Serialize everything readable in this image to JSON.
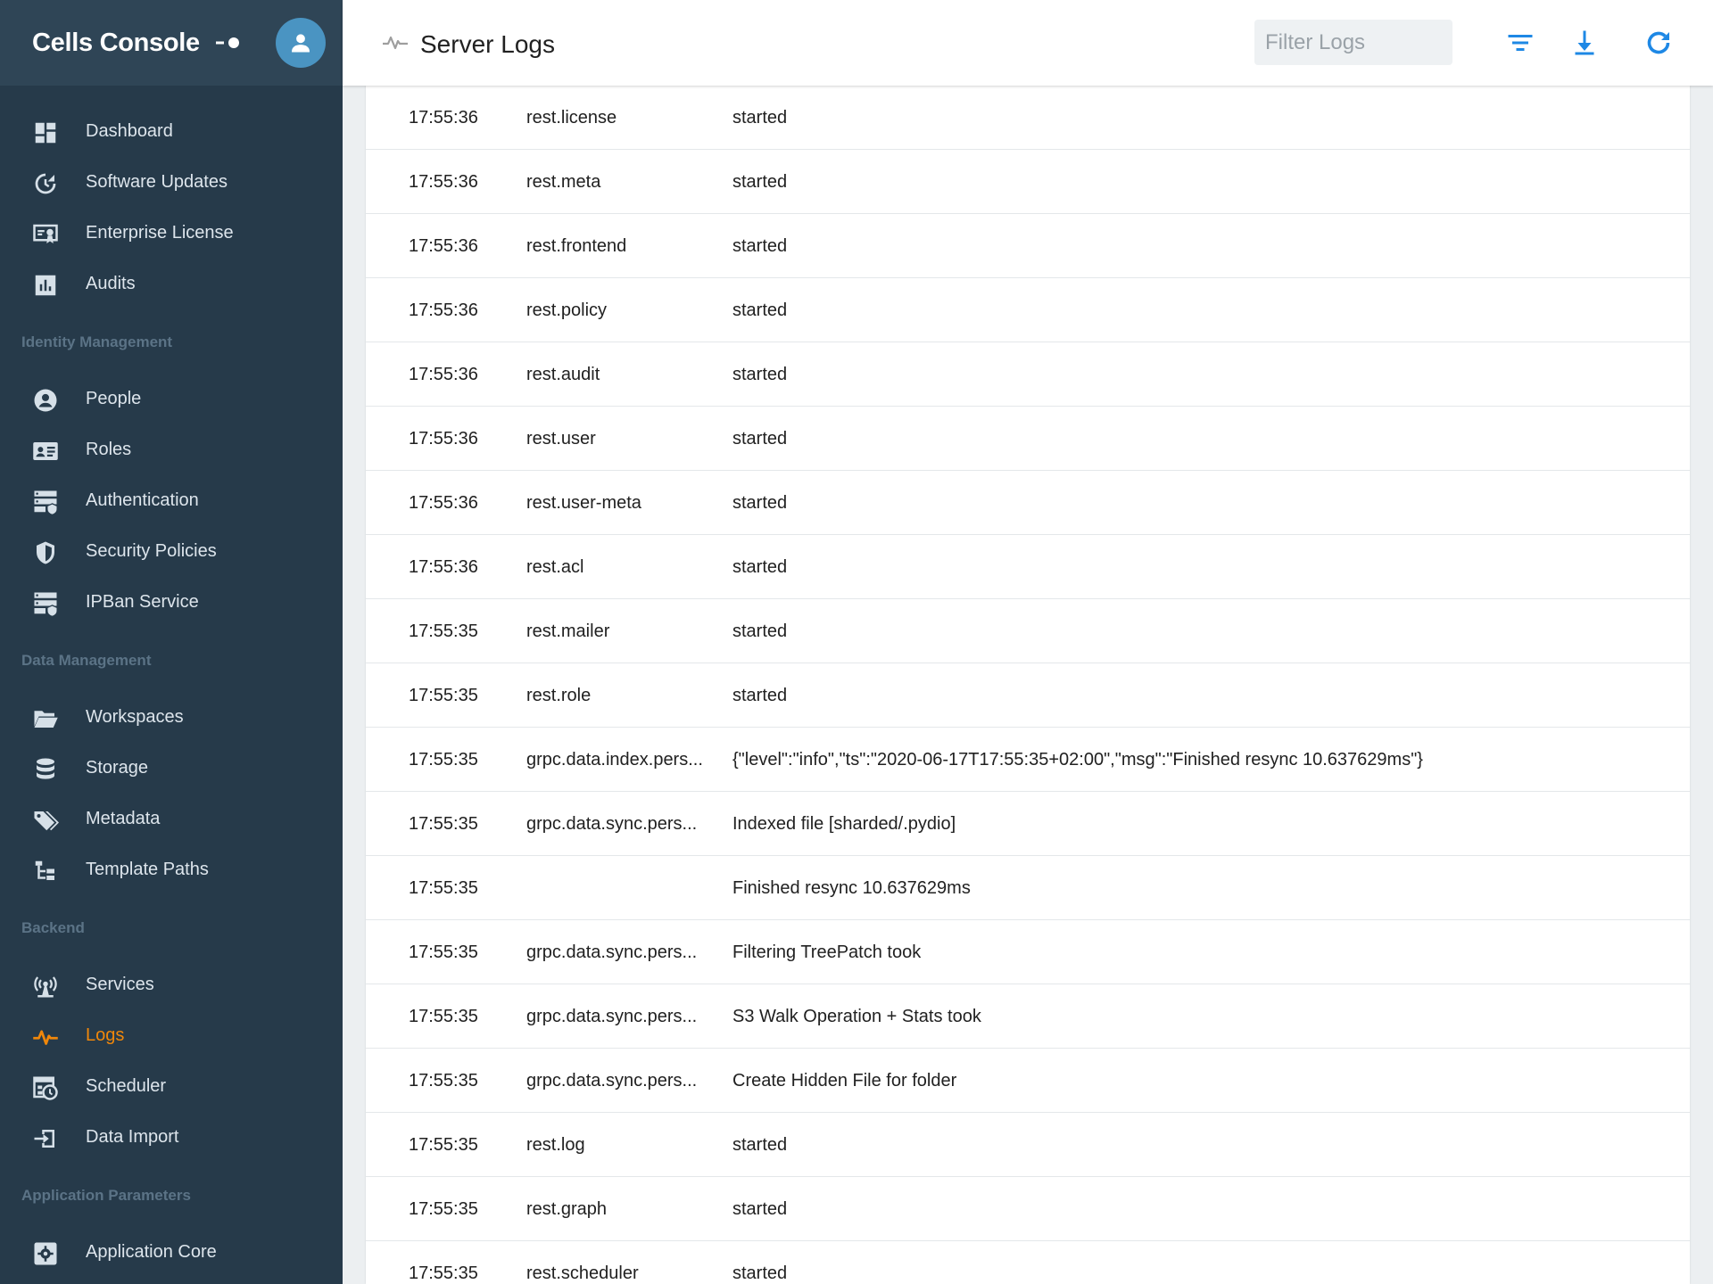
{
  "sidebar": {
    "brand": "Cells Console",
    "top_items": [
      {
        "label": "Dashboard",
        "icon": "dashboard-icon"
      },
      {
        "label": "Software Updates",
        "icon": "update-icon"
      },
      {
        "label": "Enterprise License",
        "icon": "certificate-icon"
      },
      {
        "label": "Audits",
        "icon": "chart-icon"
      }
    ],
    "sections": [
      {
        "title": "Identity Management",
        "items": [
          {
            "label": "People",
            "icon": "person-icon"
          },
          {
            "label": "Roles",
            "icon": "id-card-icon"
          },
          {
            "label": "Authentication",
            "icon": "server-shield-icon"
          },
          {
            "label": "Security Policies",
            "icon": "shield-icon"
          },
          {
            "label": "IPBan Service",
            "icon": "server-shield-icon"
          }
        ]
      },
      {
        "title": "Data Management",
        "items": [
          {
            "label": "Workspaces",
            "icon": "folder-open-icon"
          },
          {
            "label": "Storage",
            "icon": "database-icon"
          },
          {
            "label": "Metadata",
            "icon": "tags-icon"
          },
          {
            "label": "Template Paths",
            "icon": "file-tree-icon"
          }
        ]
      },
      {
        "title": "Backend",
        "items": [
          {
            "label": "Services",
            "icon": "antenna-icon"
          },
          {
            "label": "Logs",
            "icon": "pulse-icon",
            "active": true
          },
          {
            "label": "Scheduler",
            "icon": "calendar-clock-icon"
          },
          {
            "label": "Data Import",
            "icon": "import-icon"
          }
        ]
      },
      {
        "title": "Application Parameters",
        "items": [
          {
            "label": "Application Core",
            "icon": "gear-box-icon"
          }
        ]
      }
    ]
  },
  "header": {
    "title": "Server Logs",
    "filter_placeholder": "Filter Logs",
    "filter_value": ""
  },
  "colors": {
    "sidebar_bg": "#263a4a",
    "sidebar_header_bg": "#2f4556",
    "active": "#f0870a",
    "accent": "#1e88e5",
    "avatar": "#4a94c2"
  },
  "logs": [
    {
      "time": "17:55:36",
      "service": "rest.license",
      "message": "started"
    },
    {
      "time": "17:55:36",
      "service": "rest.meta",
      "message": "started"
    },
    {
      "time": "17:55:36",
      "service": "rest.frontend",
      "message": "started"
    },
    {
      "time": "17:55:36",
      "service": "rest.policy",
      "message": "started"
    },
    {
      "time": "17:55:36",
      "service": "rest.audit",
      "message": "started"
    },
    {
      "time": "17:55:36",
      "service": "rest.user",
      "message": "started"
    },
    {
      "time": "17:55:36",
      "service": "rest.user-meta",
      "message": "started"
    },
    {
      "time": "17:55:36",
      "service": "rest.acl",
      "message": "started"
    },
    {
      "time": "17:55:35",
      "service": "rest.mailer",
      "message": "started"
    },
    {
      "time": "17:55:35",
      "service": "rest.role",
      "message": "started"
    },
    {
      "time": "17:55:35",
      "service": "grpc.data.index.pers...",
      "message": "{\"level\":\"info\",\"ts\":\"2020-06-17T17:55:35+02:00\",\"msg\":\"Finished resync 10.637629ms\"}"
    },
    {
      "time": "17:55:35",
      "service": "grpc.data.sync.pers...",
      "message": "Indexed file [sharded/.pydio]"
    },
    {
      "time": "17:55:35",
      "service": "",
      "message": "Finished resync 10.637629ms"
    },
    {
      "time": "17:55:35",
      "service": "grpc.data.sync.pers...",
      "message": "Filtering TreePatch took"
    },
    {
      "time": "17:55:35",
      "service": "grpc.data.sync.pers...",
      "message": "S3 Walk Operation + Stats took"
    },
    {
      "time": "17:55:35",
      "service": "grpc.data.sync.pers...",
      "message": "Create Hidden File for folder"
    },
    {
      "time": "17:55:35",
      "service": "rest.log",
      "message": "started"
    },
    {
      "time": "17:55:35",
      "service": "rest.graph",
      "message": "started"
    },
    {
      "time": "17:55:35",
      "service": "rest.scheduler",
      "message": "started"
    }
  ]
}
